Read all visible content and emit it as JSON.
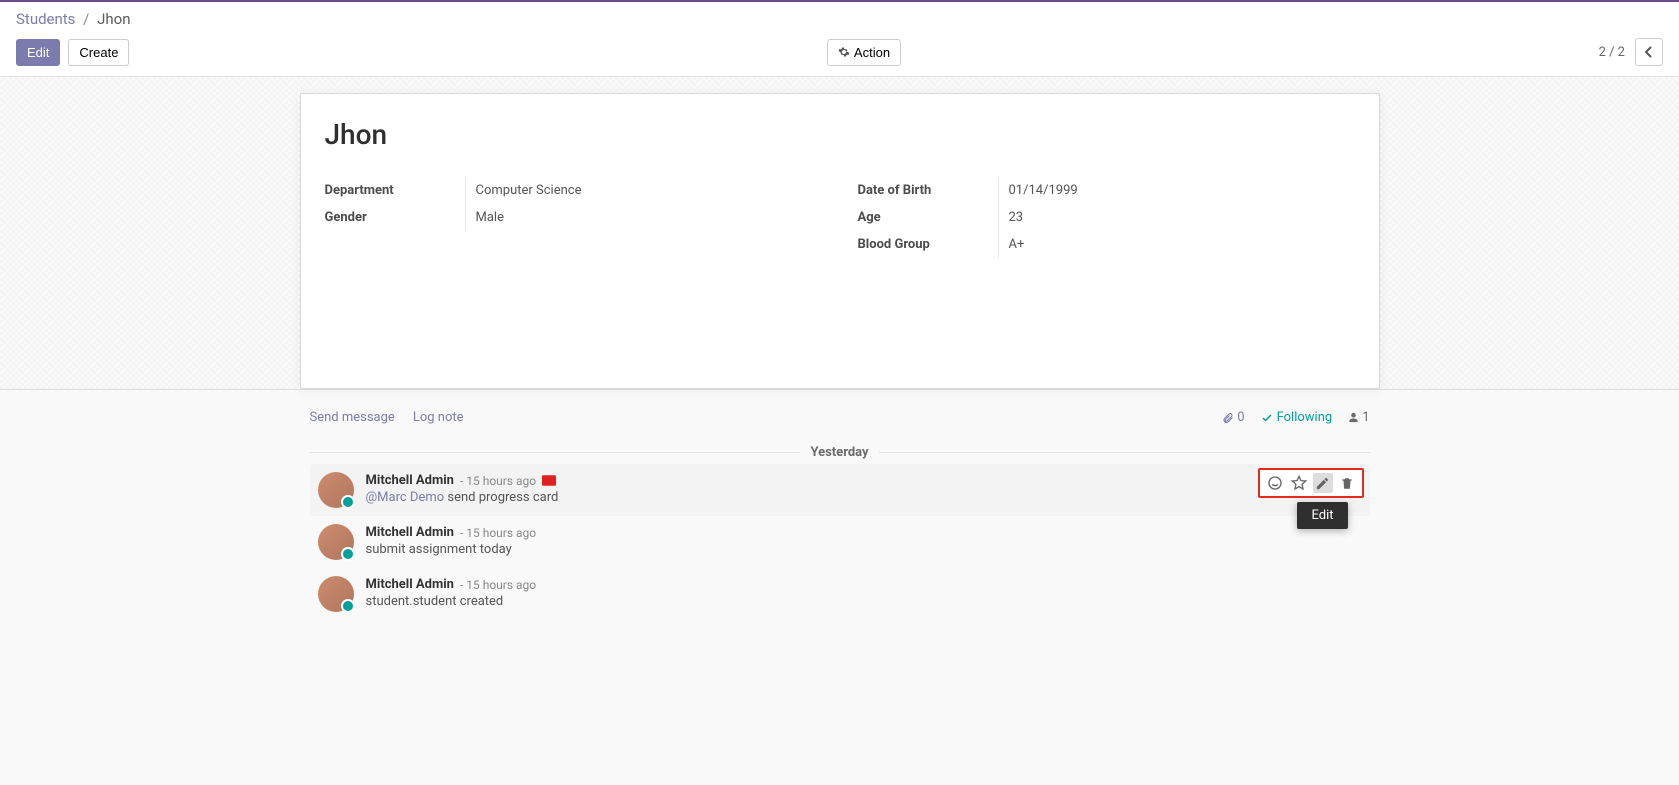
{
  "breadcrumb": {
    "root": "Students",
    "current": "Jhon"
  },
  "control": {
    "edit_label": "Edit",
    "create_label": "Create",
    "action_label": "Action",
    "pager_text": "2 / 2"
  },
  "record": {
    "title": "Jhon",
    "left_fields": [
      {
        "label": "Department",
        "value": "Computer Science"
      },
      {
        "label": "Gender",
        "value": "Male"
      }
    ],
    "right_fields": [
      {
        "label": "Date of Birth",
        "value": "01/14/1999"
      },
      {
        "label": "Age",
        "value": "23"
      },
      {
        "label": "Blood Group",
        "value": "A+"
      }
    ]
  },
  "chatter": {
    "send_message": "Send message",
    "log_note": "Log note",
    "attachment_count": "0",
    "following_label": "Following",
    "followers_count": "1",
    "date_header": "Yesterday",
    "tooltip_edit": "Edit",
    "messages": [
      {
        "author": "Mitchell Admin",
        "time": "- 15 hours ago",
        "show_envelope": true,
        "mention": "@Marc Demo",
        "body": " send progress card",
        "highlight": true,
        "show_actions": true
      },
      {
        "author": "Mitchell Admin",
        "time": "- 15 hours ago",
        "show_envelope": false,
        "mention": "",
        "body": "submit assignment today",
        "highlight": false,
        "show_actions": false
      },
      {
        "author": "Mitchell Admin",
        "time": "- 15 hours ago",
        "show_envelope": false,
        "mention": "",
        "body": "student.student created",
        "highlight": false,
        "show_actions": false
      }
    ]
  }
}
